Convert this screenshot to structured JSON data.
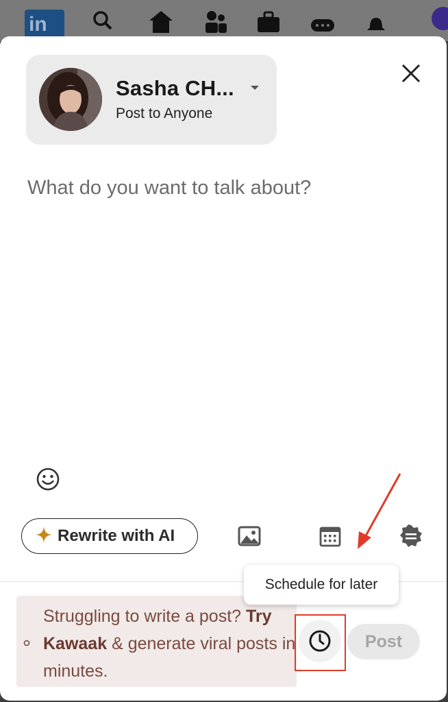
{
  "background_nav": {
    "logo_text": "in",
    "icons": [
      "search-icon",
      "home-icon",
      "network-icon",
      "jobs-icon",
      "messaging-icon",
      "notifications-icon"
    ]
  },
  "author": {
    "name": "Sasha CH...",
    "audience": "Post to Anyone"
  },
  "composer": {
    "placeholder": "What do you want to talk about?"
  },
  "toolbar": {
    "rewrite_label": "Rewrite with AI",
    "icons": [
      "emoji-icon",
      "sparkle-icon",
      "image-icon",
      "calendar-icon",
      "badge-icon"
    ]
  },
  "tooltip": {
    "text": "Schedule for later"
  },
  "promo": {
    "text_before": "Struggling to write a post? ",
    "text_bold": "Try Kawaak",
    "text_after": " & generate viral posts in minutes."
  },
  "footer": {
    "post_label": "Post",
    "schedule_icon": "clock-icon"
  },
  "colors": {
    "annotation_red": "#e03b2a",
    "sparkle": "#c9861a",
    "promo_bg": "#f1eae8",
    "promo_text": "#7a4a40"
  }
}
